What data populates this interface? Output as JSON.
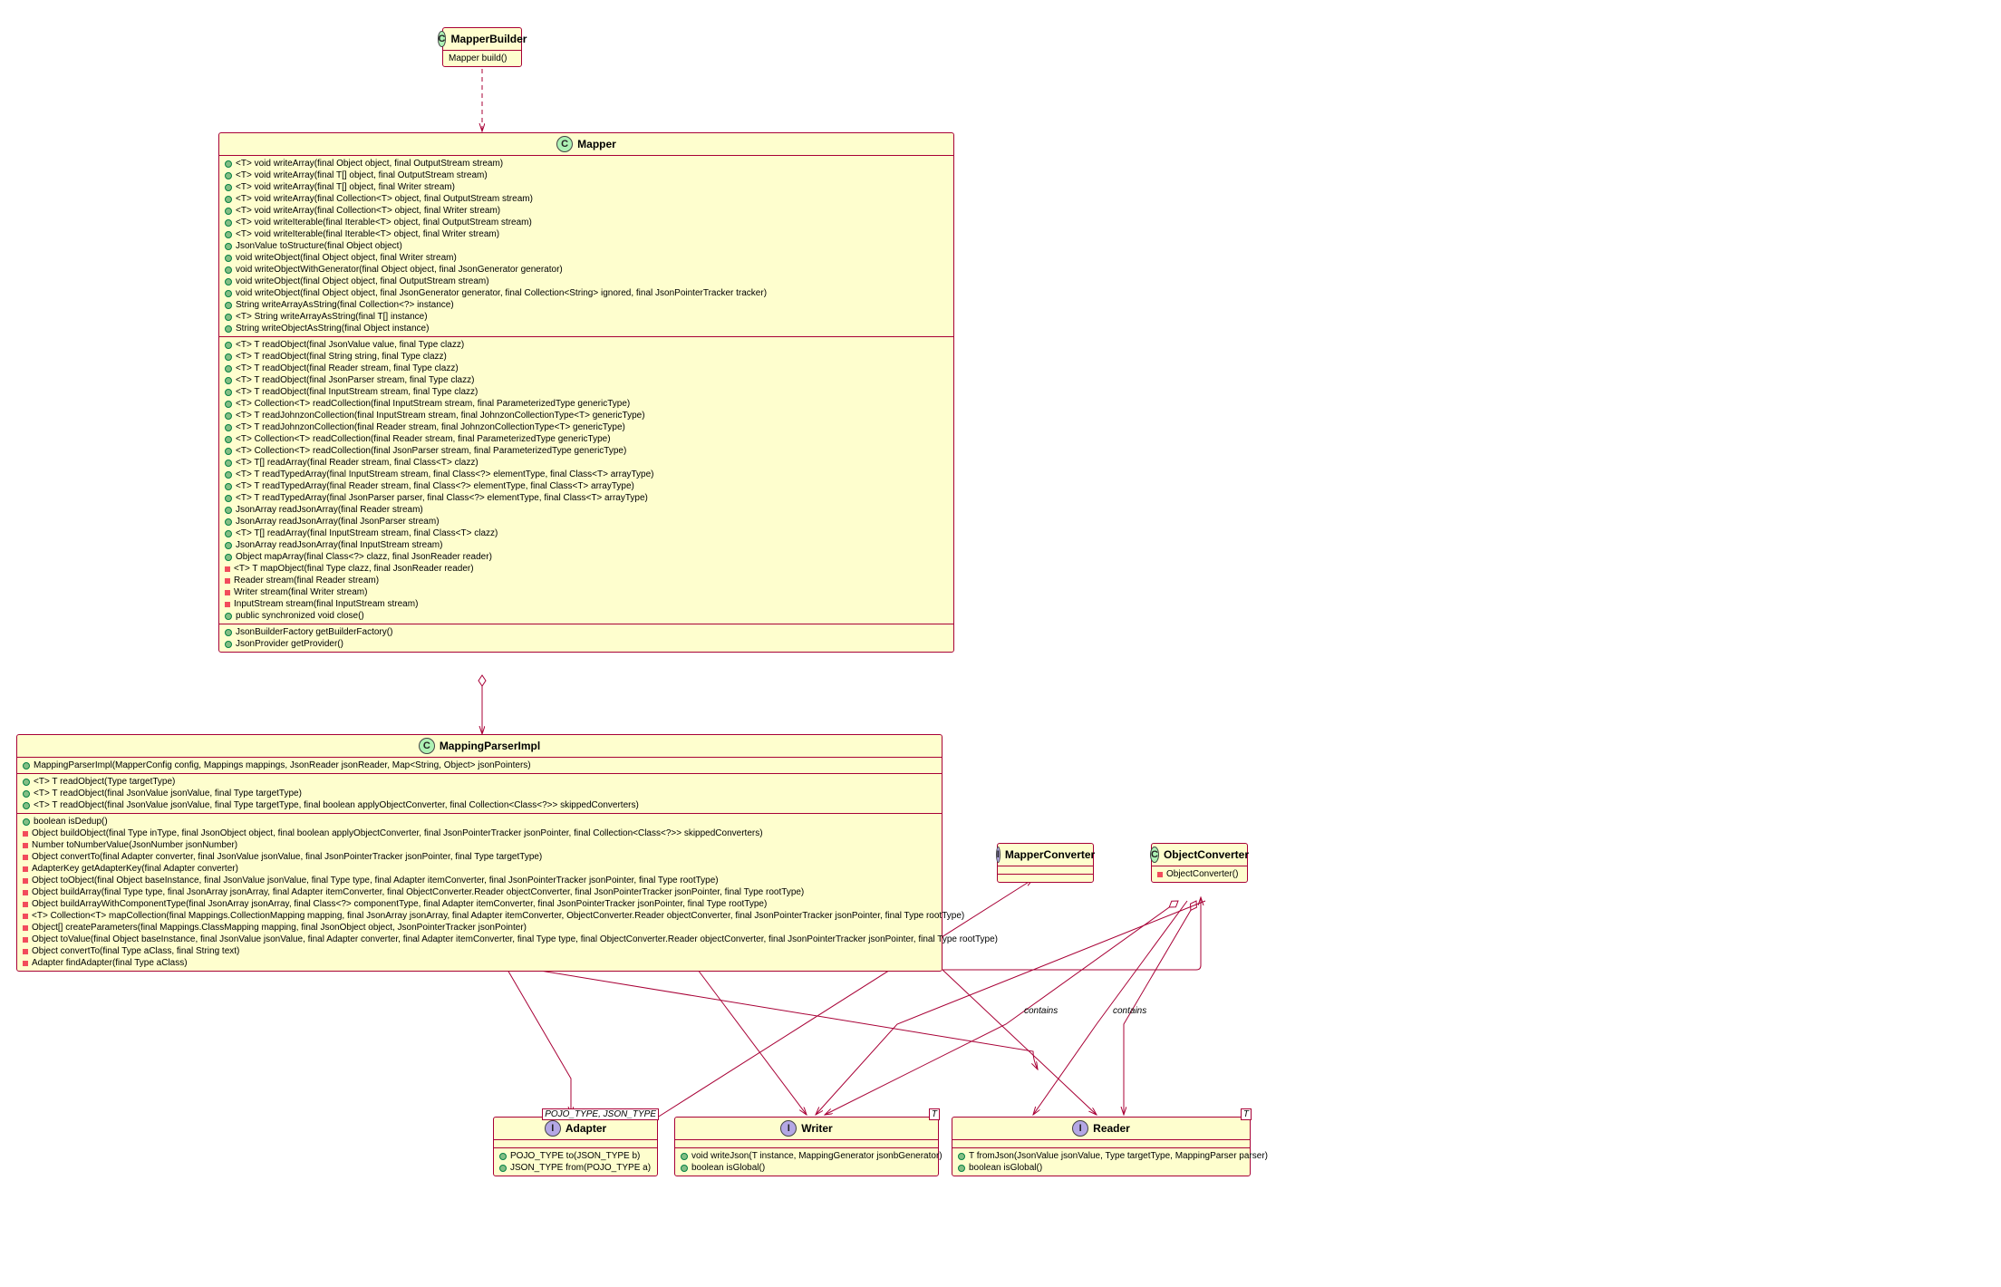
{
  "classes": {
    "mapperBuilder": {
      "name": "MapperBuilder",
      "type": "C",
      "sections": [
        [
          {
            "marker": "",
            "text": "Mapper build()"
          }
        ]
      ]
    },
    "mapper": {
      "name": "Mapper",
      "type": "C",
      "sections": [
        [
          {
            "marker": "green-circle",
            "text": "<T> void writeArray(final Object object, final OutputStream stream)"
          },
          {
            "marker": "green-circle",
            "text": "<T> void writeArray(final T[] object, final OutputStream stream)"
          },
          {
            "marker": "green-circle",
            "text": "<T> void writeArray(final T[] object, final Writer stream)"
          },
          {
            "marker": "green-circle",
            "text": "<T> void writeArray(final Collection<T> object, final OutputStream stream)"
          },
          {
            "marker": "green-circle",
            "text": "<T> void writeArray(final Collection<T> object, final Writer stream)"
          },
          {
            "marker": "green-circle",
            "text": "<T> void writeIterable(final Iterable<T> object, final OutputStream stream)"
          },
          {
            "marker": "green-circle",
            "text": "<T> void writeIterable(final Iterable<T> object, final Writer stream)"
          },
          {
            "marker": "green-circle",
            "text": "JsonValue toStructure(final Object object)"
          },
          {
            "marker": "green-circle",
            "text": "void writeObject(final Object object, final Writer stream)"
          },
          {
            "marker": "green-circle",
            "text": "void writeObjectWithGenerator(final Object object, final JsonGenerator generator)"
          },
          {
            "marker": "green-circle",
            "text": "void writeObject(final Object object, final OutputStream stream)"
          },
          {
            "marker": "green-circle",
            "text": "void writeObject(final Object object, final JsonGenerator generator, final Collection<String> ignored, final JsonPointerTracker tracker)"
          },
          {
            "marker": "green-circle",
            "text": "String writeArrayAsString(final Collection<?> instance)"
          },
          {
            "marker": "green-circle",
            "text": "<T> String writeArrayAsString(final T[] instance)"
          },
          {
            "marker": "green-circle",
            "text": "String writeObjectAsString(final Object instance)"
          }
        ],
        [
          {
            "marker": "green-circle",
            "text": "<T> T readObject(final JsonValue value, final Type clazz)"
          },
          {
            "marker": "green-circle",
            "text": "<T> T readObject(final String string, final Type clazz)"
          },
          {
            "marker": "green-circle",
            "text": "<T> T readObject(final Reader stream, final Type clazz)"
          },
          {
            "marker": "green-circle",
            "text": "<T> T readObject(final JsonParser stream, final Type clazz)"
          },
          {
            "marker": "green-circle",
            "text": "<T> T readObject(final InputStream stream, final Type clazz)"
          },
          {
            "marker": "green-circle",
            "text": "<T> Collection<T> readCollection(final InputStream stream, final ParameterizedType genericType)"
          },
          {
            "marker": "green-circle",
            "text": "<T> T readJohnzonCollection(final InputStream stream, final JohnzonCollectionType<T> genericType)"
          },
          {
            "marker": "green-circle",
            "text": "<T> T readJohnzonCollection(final Reader stream, final JohnzonCollectionType<T> genericType)"
          },
          {
            "marker": "green-circle",
            "text": "<T> Collection<T> readCollection(final Reader stream, final ParameterizedType genericType)"
          },
          {
            "marker": "green-circle",
            "text": "<T> Collection<T> readCollection(final JsonParser stream, final ParameterizedType genericType)"
          },
          {
            "marker": "green-circle",
            "text": "<T> T[] readArray(final Reader stream, final Class<T> clazz)"
          },
          {
            "marker": "green-circle",
            "text": "<T> T readTypedArray(final InputStream stream, final Class<?> elementType, final Class<T> arrayType)"
          },
          {
            "marker": "green-circle",
            "text": "<T> T readTypedArray(final Reader stream, final Class<?> elementType, final Class<T> arrayType)"
          },
          {
            "marker": "green-circle",
            "text": "<T> T readTypedArray(final JsonParser parser, final Class<?> elementType, final Class<T> arrayType)"
          },
          {
            "marker": "green-circle",
            "text": "JsonArray readJsonArray(final Reader stream)"
          },
          {
            "marker": "green-circle",
            "text": "JsonArray readJsonArray(final JsonParser stream)"
          },
          {
            "marker": "green-circle",
            "text": "<T> T[] readArray(final InputStream stream, final Class<T> clazz)"
          },
          {
            "marker": "green-circle",
            "text": "JsonArray readJsonArray(final InputStream stream)"
          },
          {
            "marker": "green-circle",
            "text": "Object mapArray(final Class<?> clazz, final JsonReader reader)"
          },
          {
            "marker": "red-square",
            "text": "<T> T mapObject(final Type clazz, final JsonReader reader)"
          },
          {
            "marker": "red-square",
            "text": "Reader stream(final Reader stream)"
          },
          {
            "marker": "red-square",
            "text": "Writer stream(final Writer stream)"
          },
          {
            "marker": "red-square",
            "text": "InputStream stream(final InputStream stream)"
          },
          {
            "marker": "green-circle",
            "text": "public synchronized void close()"
          }
        ],
        [
          {
            "marker": "green-circle",
            "text": "JsonBuilderFactory getBuilderFactory()"
          },
          {
            "marker": "green-circle",
            "text": "JsonProvider getProvider()"
          }
        ]
      ]
    },
    "mappingParserImpl": {
      "name": "MappingParserImpl",
      "type": "C",
      "sections": [
        [
          {
            "marker": "green-circle",
            "text": "MappingParserImpl(MapperConfig config, Mappings mappings, JsonReader jsonReader, Map<String, Object> jsonPointers)"
          }
        ],
        [
          {
            "marker": "green-circle",
            "text": "<T> T readObject(Type targetType)"
          },
          {
            "marker": "green-circle",
            "text": "<T> T readObject(final JsonValue jsonValue, final Type targetType)"
          },
          {
            "marker": "green-circle",
            "text": "<T> T readObject(final JsonValue jsonValue, final Type targetType, final boolean applyObjectConverter, final Collection<Class<?>> skippedConverters)"
          }
        ],
        [
          {
            "marker": "green-circle",
            "text": "boolean isDedup()"
          },
          {
            "marker": "red-square",
            "text": "Object buildObject(final Type inType, final JsonObject object, final boolean applyObjectConverter, final JsonPointerTracker jsonPointer, final Collection<Class<?>> skippedConverters)"
          },
          {
            "marker": "red-square",
            "text": "Number toNumberValue(JsonNumber jsonNumber)"
          },
          {
            "marker": "red-square",
            "text": "Object convertTo(final Adapter converter, final JsonValue jsonValue, final JsonPointerTracker jsonPointer, final Type targetType)"
          },
          {
            "marker": "red-square",
            "text": "AdapterKey getAdapterKey(final Adapter converter)"
          },
          {
            "marker": "red-square",
            "text": "Object toObject(final Object baseInstance, final JsonValue jsonValue, final Type type, final Adapter itemConverter, final JsonPointerTracker jsonPointer, final Type rootType)"
          },
          {
            "marker": "red-square",
            "text": "Object buildArray(final Type type, final JsonArray jsonArray, final Adapter itemConverter, final ObjectConverter.Reader objectConverter, final JsonPointerTracker jsonPointer, final Type rootType)"
          },
          {
            "marker": "red-square",
            "text": "Object buildArrayWithComponentType(final JsonArray jsonArray, final Class<?> componentType, final Adapter itemConverter, final JsonPointerTracker jsonPointer, final Type rootType)"
          },
          {
            "marker": "red-square",
            "text": "<T> Collection<T> mapCollection(final Mappings.CollectionMapping mapping, final JsonArray jsonArray, final Adapter itemConverter, ObjectConverter.Reader objectConverter, final JsonPointerTracker jsonPointer, final Type rootType)"
          },
          {
            "marker": "red-square",
            "text": "Object[] createParameters(final Mappings.ClassMapping mapping, final JsonObject object, JsonPointerTracker jsonPointer)"
          },
          {
            "marker": "red-square",
            "text": "Object toValue(final Object baseInstance, final JsonValue jsonValue, final Adapter converter, final Adapter itemConverter, final Type type, final ObjectConverter.Reader objectConverter, final JsonPointerTracker jsonPointer, final Type rootType)"
          },
          {
            "marker": "red-square",
            "text": "Object convertTo(final Type aClass, final String text)"
          },
          {
            "marker": "red-square",
            "text": "Adapter findAdapter(final Type aClass)"
          }
        ]
      ]
    },
    "mapperConverter": {
      "name": "MapperConverter",
      "type": "I",
      "sections": [
        [],
        []
      ]
    },
    "objectConverter": {
      "name": "ObjectConverter",
      "type": "C",
      "sections": [
        [
          {
            "marker": "red-square",
            "text": "ObjectConverter()"
          }
        ]
      ]
    },
    "adapter": {
      "name": "Adapter",
      "type": "I",
      "typeParams": "POJO_TYPE, JSON_TYPE",
      "sections": [
        [
          {
            "marker": "green-circle",
            "text": "POJO_TYPE to(JSON_TYPE b)"
          },
          {
            "marker": "green-circle",
            "text": "JSON_TYPE from(POJO_TYPE a)"
          }
        ]
      ]
    },
    "writer": {
      "name": "Writer",
      "type": "I",
      "typeParams": "T",
      "sections": [
        [
          {
            "marker": "green-circle",
            "text": "void writeJson(T instance, MappingGenerator jsonbGenerator)"
          },
          {
            "marker": "green-circle",
            "text": "boolean isGlobal()"
          }
        ]
      ]
    },
    "reader": {
      "name": "Reader",
      "type": "I",
      "typeParams": "T",
      "sections": [
        [
          {
            "marker": "green-circle",
            "text": "T fromJson(JsonValue jsonValue, Type targetType, MappingParser parser)"
          },
          {
            "marker": "green-circle",
            "text": "boolean isGlobal()"
          }
        ]
      ]
    }
  },
  "labels": {
    "contains1": "contains",
    "contains2": "contains"
  }
}
